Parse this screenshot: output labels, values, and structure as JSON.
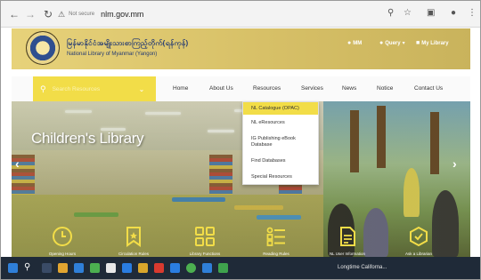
{
  "browser": {
    "not_secure": "Not secure",
    "url": "nlm.gov.mm"
  },
  "site": {
    "org_name_mm": "မြန်မာနိုင်ငံအမျိုးသားစာကြည့်တိုက်(ရန်ကုန်)",
    "org_name_en": "National Library of Myanmar (Yangon)",
    "utility": {
      "mm": "MM",
      "query": "Query",
      "my_library": "My Library"
    },
    "search": {
      "placeholder": "Search Resources"
    },
    "nav": [
      "Home",
      "About Us",
      "Resources",
      "Services",
      "News",
      "Notice",
      "Contact Us"
    ],
    "resources_menu": [
      "NL Catalogue (OPAC)",
      "NL eResources",
      "IG Publishing eBook Database",
      "Find Databases",
      "Special Resources"
    ],
    "hero_title": "Children's Library",
    "quick_links": [
      {
        "label": "Opening Hours",
        "icon": "clock-icon"
      },
      {
        "label": "Circulation Rules",
        "icon": "bookmark-star-icon"
      },
      {
        "label": "Library Functions",
        "icon": "grid-icon"
      },
      {
        "label": "Reading Rules",
        "icon": "list-icon"
      },
      {
        "label": "NL User Information",
        "icon": "document-icon"
      },
      {
        "label": "Ask a Librarian",
        "icon": "cube-check-icon"
      }
    ]
  },
  "taskbar": {
    "weather": "Longtime Californa..."
  },
  "colors": {
    "accent_yellow": "#f2dd48",
    "header_gold": "#d7c067",
    "text_blue": "#233a73"
  }
}
